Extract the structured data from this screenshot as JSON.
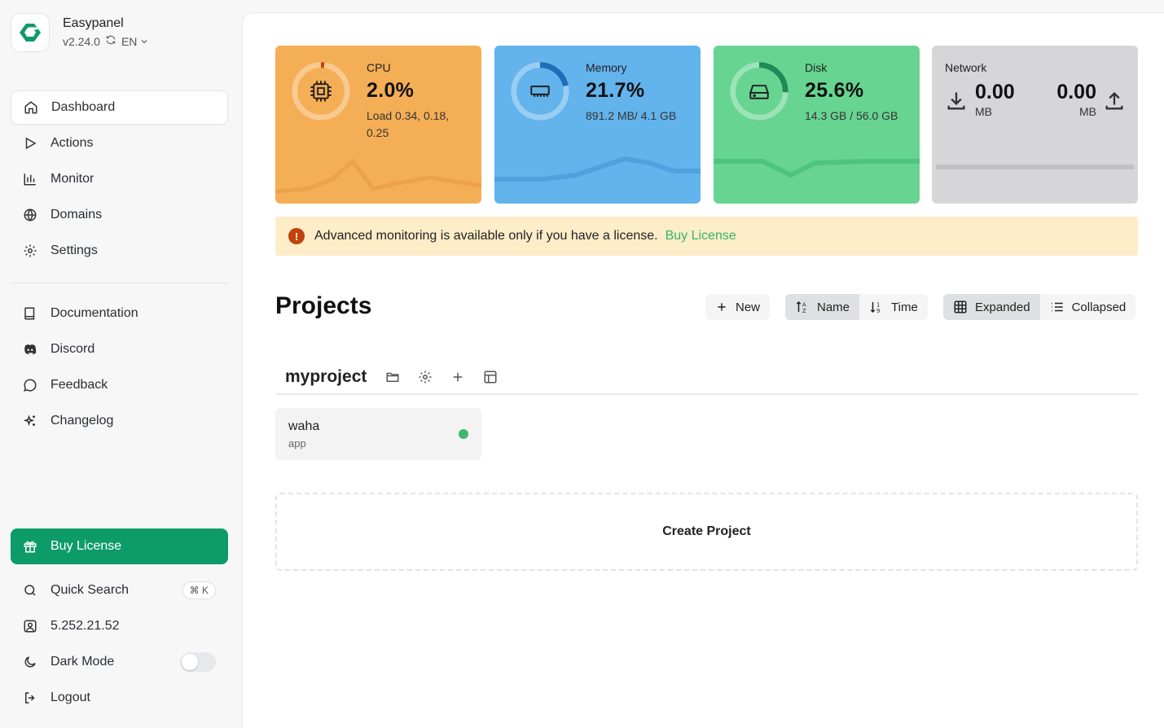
{
  "brand": {
    "name": "Easypanel",
    "version": "v2.24.0",
    "language": "EN"
  },
  "nav": {
    "dashboard": "Dashboard",
    "actions": "Actions",
    "monitor": "Monitor",
    "domains": "Domains",
    "settings": "Settings",
    "documentation": "Documentation",
    "discord": "Discord",
    "feedback": "Feedback",
    "changelog": "Changelog"
  },
  "footer": {
    "buy_license": "Buy License",
    "quick_search": "Quick Search",
    "quick_search_shortcut": "⌘ K",
    "ip": "5.252.21.52",
    "dark_mode": "Dark Mode",
    "logout": "Logout"
  },
  "stats": {
    "cpu": {
      "label": "CPU",
      "value": "2.0%",
      "sub": "Load 0.34, 0.18, 0.25",
      "color": "#f4ae55",
      "level": 0.02
    },
    "memory": {
      "label": "Memory",
      "value": "21.7%",
      "sub": "891.2 MB/ 4.1 GB",
      "color": "#63b3ec",
      "level": 0.217
    },
    "disk": {
      "label": "Disk",
      "value": "25.6%",
      "sub": "14.3 GB / 56.0 GB",
      "color": "#67d491",
      "level": 0.256
    },
    "network": {
      "label": "Network",
      "down_value": "0.00",
      "down_unit": "MB",
      "up_value": "0.00",
      "up_unit": "MB",
      "color": "#d6d6d9"
    }
  },
  "alert": {
    "text": "Advanced monitoring is available only if you have a license.",
    "link": "Buy License"
  },
  "projects": {
    "title": "Projects",
    "new_label": "New",
    "sort_name": "Name",
    "sort_time": "Time",
    "view_expanded": "Expanded",
    "view_collapsed": "Collapsed",
    "create_label": "Create Project",
    "items": [
      {
        "name": "myproject",
        "services": [
          {
            "name": "waha",
            "type": "app",
            "status": "running"
          }
        ]
      }
    ]
  },
  "colors": {
    "accent": "#0e9b6a",
    "alert_bg": "#fdedc8",
    "alert_icon": "#c2410c",
    "link": "#34b36a",
    "status_ok": "#3fb971"
  }
}
